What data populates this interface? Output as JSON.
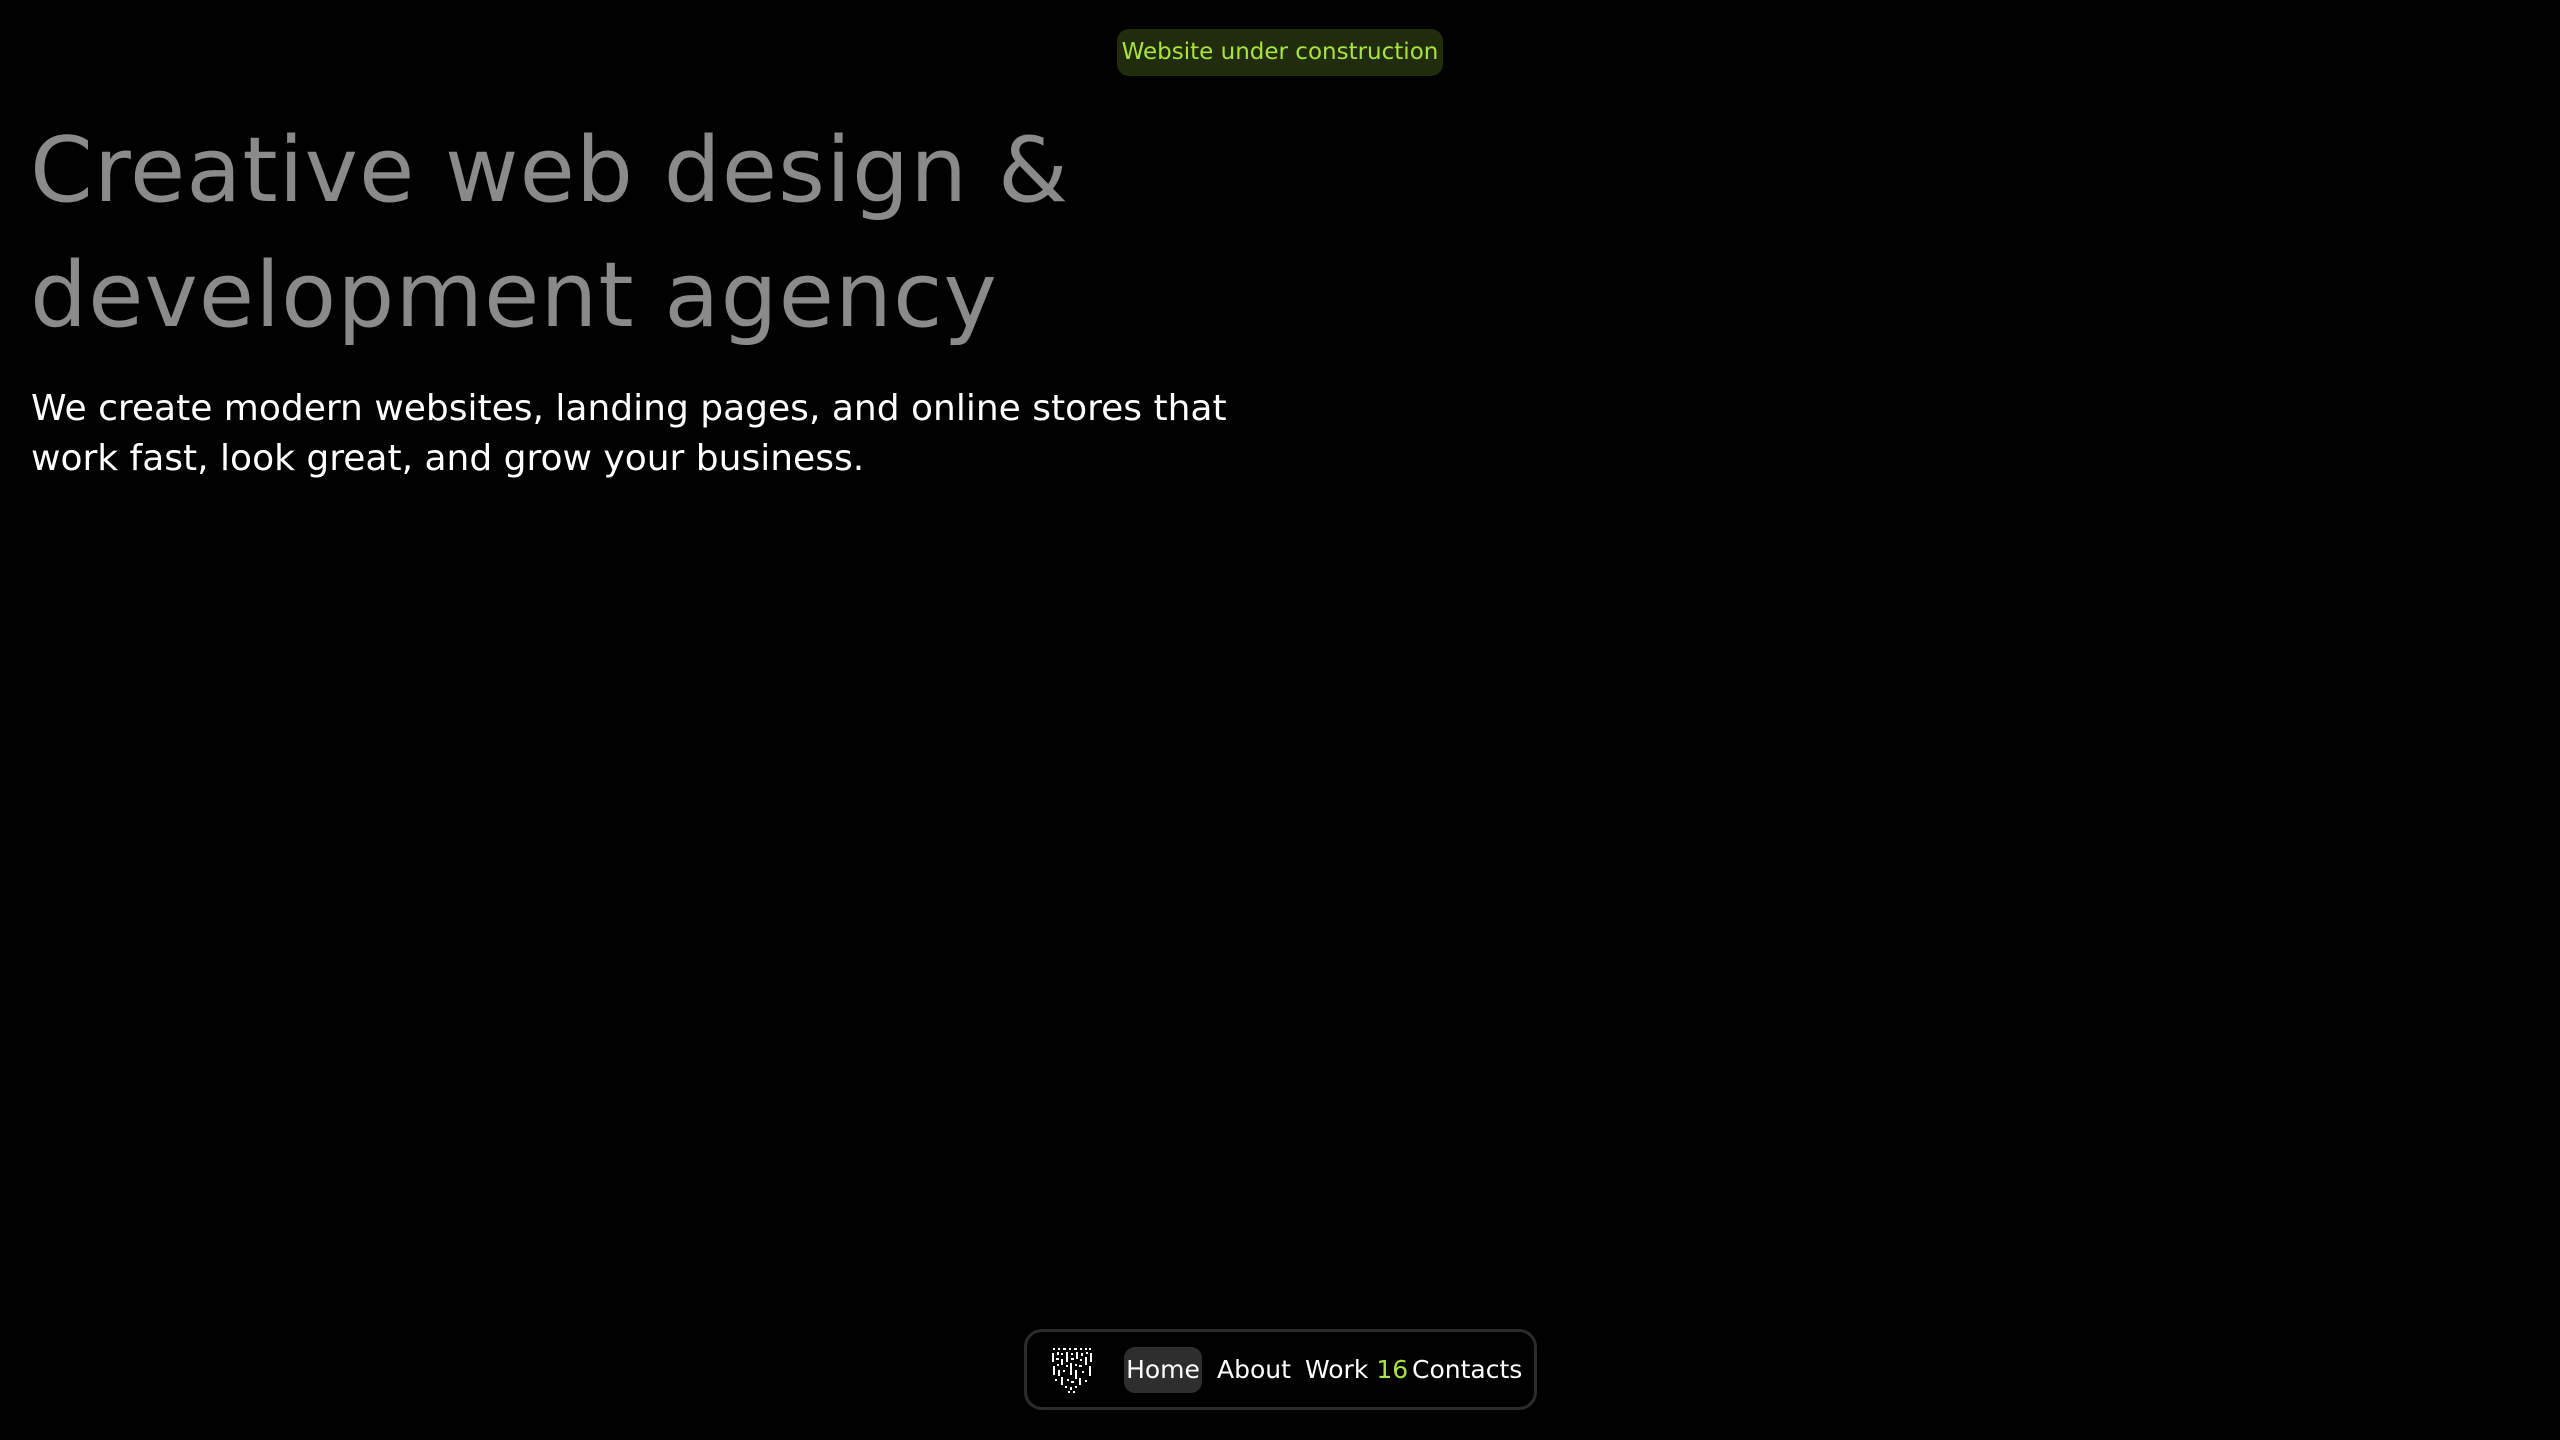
{
  "badge": {
    "text": "Website under construction"
  },
  "hero": {
    "title_line1": "Creative web design &",
    "title_line2": "development agency",
    "subtitle_line1": "We create modern websites, landing pages, and online stores that",
    "subtitle_line2": "work fast, look great, and grow your business."
  },
  "nav": {
    "logo_icon": "abstract-logo-icon",
    "items": [
      {
        "label": "Home",
        "active": true
      },
      {
        "label": "About"
      },
      {
        "label": "Work",
        "count": "16"
      },
      {
        "label": "Contacts"
      }
    ]
  },
  "colors": {
    "background": "#000000",
    "accent": "#a9e33f",
    "title_gray": "#8a8a8a",
    "active_pill": "#2e2e2e"
  }
}
